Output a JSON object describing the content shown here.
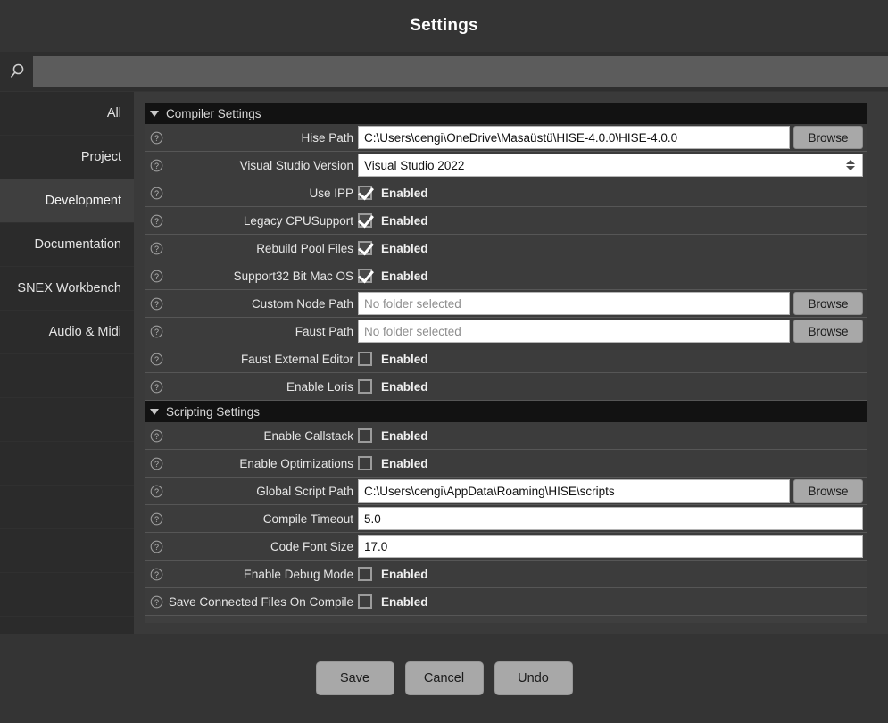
{
  "window": {
    "title": "Settings"
  },
  "search": {
    "icon": "search-icon",
    "value": "",
    "placeholder": ""
  },
  "sidebar": {
    "items": [
      {
        "label": "All",
        "active": false
      },
      {
        "label": "Project",
        "active": false
      },
      {
        "label": "Development",
        "active": true
      },
      {
        "label": "Documentation",
        "active": false
      },
      {
        "label": "SNEX Workbench",
        "active": false
      },
      {
        "label": "Audio & Midi",
        "active": false
      }
    ]
  },
  "sections": [
    {
      "title": "Compiler Settings",
      "collapse_icon": "triangle-down-icon",
      "rows": [
        {
          "label": "Hise Path",
          "type": "path",
          "value": "C:\\Users\\cengi\\OneDrive\\Masaüstü\\HISE-4.0.0\\HISE-4.0.0",
          "placeholder": "No folder selected",
          "button": "Browse",
          "help_icon": "help-circle-icon"
        },
        {
          "label": "Visual Studio Version",
          "type": "combo",
          "value": "Visual Studio 2022",
          "help_icon": "help-circle-icon"
        },
        {
          "label": "Use IPP",
          "type": "checkbox",
          "checked": true,
          "state_label": "Enabled",
          "help_icon": "help-circle-icon"
        },
        {
          "label": "Legacy CPUSupport",
          "type": "checkbox",
          "checked": true,
          "state_label": "Enabled",
          "help_icon": "help-circle-icon"
        },
        {
          "label": "Rebuild Pool Files",
          "type": "checkbox",
          "checked": true,
          "state_label": "Enabled",
          "help_icon": "help-circle-icon"
        },
        {
          "label": "Support32 Bit Mac OS",
          "type": "checkbox",
          "checked": true,
          "state_label": "Enabled",
          "help_icon": "help-circle-icon"
        },
        {
          "label": "Custom Node Path",
          "type": "path",
          "value": "",
          "placeholder": "No folder selected",
          "button": "Browse",
          "help_icon": "help-circle-icon"
        },
        {
          "label": "Faust Path",
          "type": "path",
          "value": "",
          "placeholder": "No folder selected",
          "button": "Browse",
          "help_icon": "help-circle-icon"
        },
        {
          "label": "Faust External Editor",
          "type": "checkbox",
          "checked": false,
          "state_label": "Enabled",
          "help_icon": "help-circle-icon"
        },
        {
          "label": "Enable Loris",
          "type": "checkbox",
          "checked": false,
          "state_label": "Enabled",
          "help_icon": "help-circle-icon"
        }
      ]
    },
    {
      "title": "Scripting Settings",
      "collapse_icon": "triangle-down-icon",
      "rows": [
        {
          "label": "Enable Callstack",
          "type": "checkbox",
          "checked": false,
          "state_label": "Enabled",
          "help_icon": "help-circle-icon"
        },
        {
          "label": "Enable Optimizations",
          "type": "checkbox",
          "checked": false,
          "state_label": "Enabled",
          "help_icon": "help-circle-icon"
        },
        {
          "label": "Global Script Path",
          "type": "path",
          "value": "C:\\Users\\cengi\\AppData\\Roaming\\HISE\\scripts",
          "placeholder": "No folder selected",
          "button": "Browse",
          "help_icon": "help-circle-icon"
        },
        {
          "label": "Compile Timeout",
          "type": "text",
          "value": "5.0",
          "help_icon": "help-circle-icon"
        },
        {
          "label": "Code Font Size",
          "type": "text",
          "value": "17.0",
          "help_icon": "help-circle-icon"
        },
        {
          "label": "Enable Debug Mode",
          "type": "checkbox",
          "checked": false,
          "state_label": "Enabled",
          "help_icon": "help-circle-icon"
        },
        {
          "label": "Save Connected Files On Compile",
          "type": "checkbox",
          "checked": false,
          "state_label": "Enabled",
          "help_icon": "help-circle-icon",
          "label_overflow": true
        }
      ]
    }
  ],
  "footer": {
    "buttons": [
      {
        "label": "Save"
      },
      {
        "label": "Cancel"
      },
      {
        "label": "Undo"
      }
    ]
  },
  "colors": {
    "window_bg": "#343434",
    "sidebar_bg": "#2b2b2b",
    "sidebar_active": "#3f3f3f",
    "row_bg": "#3c3c3c",
    "section_header_bg": "#121212",
    "field_bg": "#ffffff",
    "button_bg": "#a8a8a8",
    "search_bg": "#5c5c5c"
  }
}
